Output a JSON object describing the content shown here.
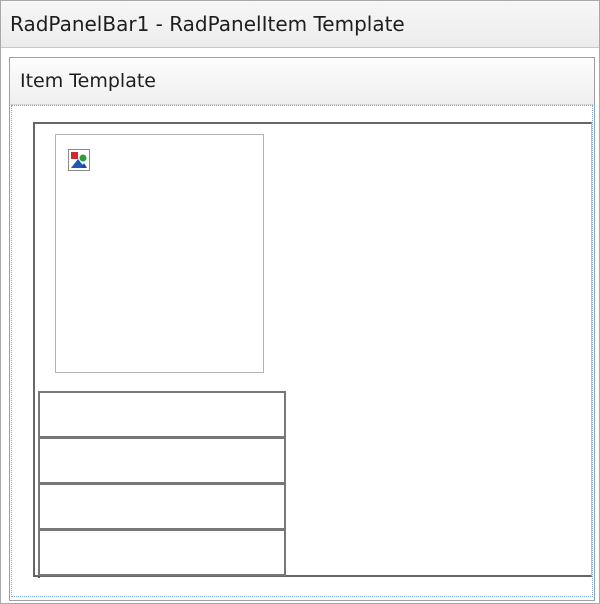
{
  "panel": {
    "title": "RadPanelBar1 - RadPanelItem Template"
  },
  "template": {
    "header_label": "Item Template"
  },
  "content": {
    "image_icon": "broken-image-placeholder-icon",
    "field_cells": 4
  },
  "colors": {
    "border": "#a9a9a9",
    "dotted_border": "#7aa6d6",
    "table_border": "#666666"
  }
}
